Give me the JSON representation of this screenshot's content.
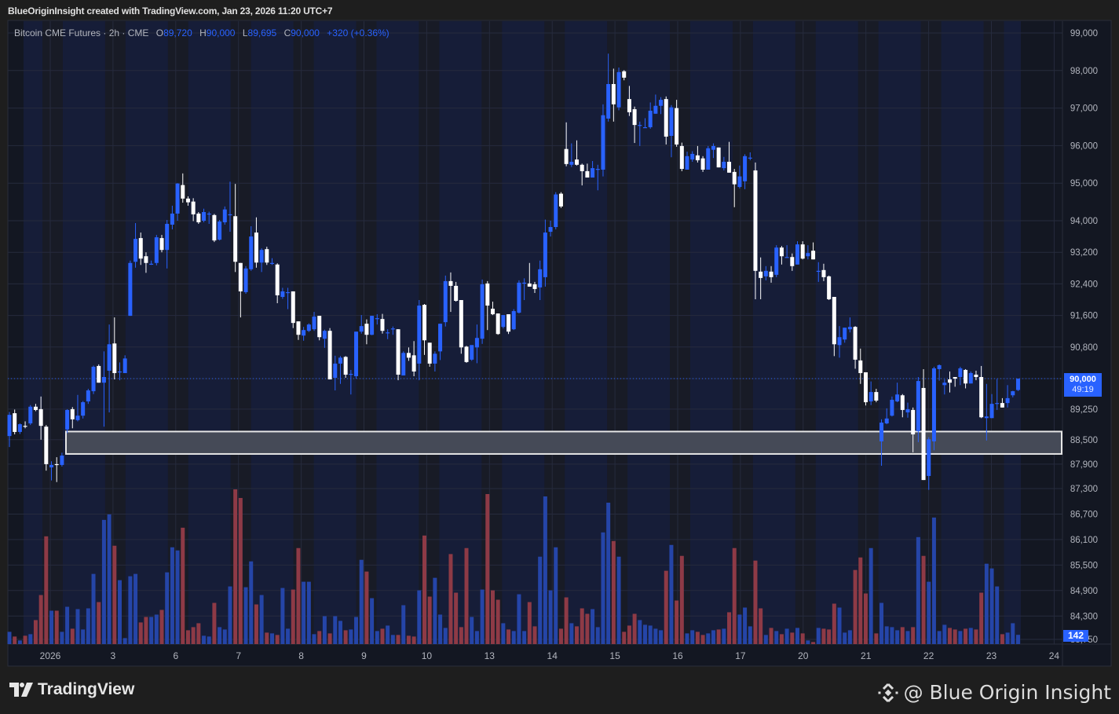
{
  "header": {
    "attribution": "BlueOriginInsight created with TradingView.com, Jan 23, 2026 11:20 UTC+7"
  },
  "legend": {
    "symbol": "Bitcoin CME Futures · 2h · CME",
    "open_label": "O",
    "open": "89,720",
    "high_label": "H",
    "high": "90,000",
    "low_label": "L",
    "low": "89,695",
    "close_label": "C",
    "close": "90,000",
    "change": "+320 (+0.36%)"
  },
  "current_price": {
    "value": "90,000",
    "countdown": "49:19"
  },
  "current_volume": "142",
  "footer": {
    "brand": "TradingView",
    "watermark": "@ Blue Origin Insight"
  },
  "colors": {
    "up": "#2962ff",
    "down": "#ffffff",
    "vol_up": "#2545a8",
    "vol_down": "#8e3a46",
    "accent": "#2962ff"
  },
  "chart_data": {
    "type": "candlestick",
    "title": "Bitcoin CME Futures · 2h · CME",
    "ylim": [
      83750,
      99000
    ],
    "y_ticks": [
      "99,000",
      "98,000",
      "97,000",
      "96,000",
      "95,000",
      "94,000",
      "93,200",
      "92,400",
      "91,600",
      "90,800",
      "90,000",
      "89,250",
      "88,500",
      "87,900",
      "87,300",
      "86,700",
      "86,100",
      "85,500",
      "84,900",
      "84,300",
      "83,750"
    ],
    "x_ticks": [
      "2026",
      "3",
      "6",
      "7",
      "8",
      "9",
      "10",
      "13",
      "14",
      "15",
      "16",
      "17",
      "20",
      "21",
      "22",
      "23",
      "24"
    ],
    "zone": {
      "top": 88700,
      "bottom": 88150
    },
    "current_price": 90000,
    "ohlc": [
      [
        88590,
        89180,
        88320,
        89110
      ],
      [
        89150,
        89240,
        88630,
        88690
      ],
      [
        88690,
        88900,
        88640,
        88880
      ],
      [
        88840,
        88950,
        88780,
        88820
      ],
      [
        88900,
        89350,
        88860,
        89310
      ],
      [
        89310,
        89380,
        89200,
        89230
      ],
      [
        89250,
        89560,
        88500,
        88840
      ],
      [
        88820,
        88860,
        87740,
        87900
      ],
      [
        87820,
        87970,
        87500,
        87880
      ],
      [
        87900,
        88070,
        87460,
        87880
      ],
      [
        87880,
        88180,
        87840,
        88110
      ],
      [
        88750,
        89250,
        88660,
        89230
      ],
      [
        89250,
        89300,
        88780,
        89000
      ],
      [
        88980,
        89600,
        88950,
        89090
      ],
      [
        89090,
        89450,
        89020,
        89420
      ],
      [
        89440,
        89750,
        89380,
        89710
      ],
      [
        89690,
        90330,
        89620,
        90300
      ],
      [
        90320,
        90360,
        89900,
        89900
      ],
      [
        89900,
        90690,
        88820,
        90040
      ],
      [
        90200,
        91370,
        89170,
        90870
      ],
      [
        90890,
        91550,
        89980,
        90140
      ],
      [
        90180,
        90410,
        89960,
        90180
      ],
      [
        90140,
        90590,
        90140,
        90510
      ],
      [
        91590,
        92990,
        91590,
        92930
      ],
      [
        92960,
        93940,
        92810,
        93540
      ],
      [
        93560,
        93700,
        92880,
        93040
      ],
      [
        93100,
        93200,
        92680,
        92930
      ],
      [
        92910,
        92990,
        92880,
        92910
      ],
      [
        92930,
        93640,
        92870,
        93580
      ],
      [
        93560,
        93640,
        93200,
        93260
      ],
      [
        93260,
        94020,
        92790,
        93920
      ],
      [
        93900,
        94400,
        93780,
        94190
      ],
      [
        94190,
        95000,
        94000,
        94990
      ],
      [
        94950,
        95260,
        94480,
        94590
      ],
      [
        94590,
        94650,
        94400,
        94490
      ],
      [
        94510,
        94600,
        93990,
        94170
      ],
      [
        94190,
        94230,
        93920,
        93960
      ],
      [
        94000,
        94320,
        93960,
        94230
      ],
      [
        94190,
        94240,
        93920,
        94190
      ],
      [
        94150,
        94180,
        93460,
        93500
      ],
      [
        93520,
        94020,
        93500,
        93980
      ],
      [
        93960,
        94380,
        93900,
        94300
      ],
      [
        94170,
        95040,
        93720,
        94170
      ],
      [
        94120,
        94980,
        92700,
        92960
      ],
      [
        92930,
        92930,
        91550,
        92210
      ],
      [
        92190,
        92850,
        92150,
        92790
      ],
      [
        92770,
        93860,
        92730,
        93600
      ],
      [
        93700,
        94090,
        92810,
        92940
      ],
      [
        92940,
        93300,
        92700,
        93260
      ],
      [
        93280,
        93340,
        92880,
        92940
      ],
      [
        92930,
        93050,
        92880,
        92930
      ],
      [
        92890,
        92920,
        91910,
        92110
      ],
      [
        92070,
        92300,
        92020,
        92210
      ],
      [
        92190,
        92300,
        91760,
        92190
      ],
      [
        92210,
        92210,
        91280,
        91410
      ],
      [
        91450,
        91450,
        90980,
        91110
      ],
      [
        91090,
        91310,
        90960,
        91230
      ],
      [
        91210,
        91400,
        91180,
        91370
      ],
      [
        91250,
        91690,
        91210,
        91570
      ],
      [
        91590,
        91590,
        90970,
        91050
      ],
      [
        91010,
        91240,
        90780,
        91210
      ],
      [
        91210,
        91280,
        89980,
        89980
      ],
      [
        90020,
        90580,
        89710,
        90380
      ],
      [
        90380,
        90570,
        89870,
        90530
      ],
      [
        90550,
        90570,
        90020,
        90100
      ],
      [
        90120,
        90220,
        89610,
        90120
      ],
      [
        90060,
        91190,
        90000,
        91190
      ],
      [
        91190,
        91610,
        91140,
        91330
      ],
      [
        91390,
        91500,
        90870,
        91110
      ],
      [
        91110,
        91590,
        91100,
        91590
      ],
      [
        91530,
        91630,
        91370,
        91530
      ],
      [
        91510,
        91640,
        91140,
        91210
      ],
      [
        91170,
        91250,
        91000,
        91170
      ],
      [
        91270,
        91320,
        91110,
        91270
      ],
      [
        91250,
        91250,
        89960,
        90100
      ],
      [
        90080,
        90690,
        90080,
        90650
      ],
      [
        90650,
        90790,
        90450,
        90530
      ],
      [
        90590,
        90950,
        90060,
        90180
      ],
      [
        90380,
        91990,
        89960,
        91850
      ],
      [
        91870,
        91890,
        90600,
        90970
      ],
      [
        90910,
        90910,
        90300,
        90380
      ],
      [
        90380,
        90690,
        90180,
        90630
      ],
      [
        90690,
        91390,
        90470,
        91390
      ],
      [
        91430,
        92610,
        91320,
        92470
      ],
      [
        92470,
        92690,
        91690,
        92350
      ],
      [
        92350,
        92450,
        91950,
        91970
      ],
      [
        91990,
        91990,
        90630,
        90790
      ],
      [
        90810,
        90830,
        90400,
        90420
      ],
      [
        90480,
        90830,
        90450,
        90850
      ],
      [
        90790,
        91370,
        90390,
        91030
      ],
      [
        91010,
        92510,
        90880,
        92390
      ],
      [
        92410,
        92470,
        91230,
        91850
      ],
      [
        91770,
        91950,
        91610,
        91630
      ],
      [
        91650,
        91650,
        91110,
        91130
      ],
      [
        91310,
        91610,
        91270,
        91610
      ],
      [
        91630,
        91630,
        91130,
        91190
      ],
      [
        91250,
        91760,
        91230,
        91710
      ],
      [
        91670,
        92490,
        91650,
        92430
      ],
      [
        92430,
        92540,
        91990,
        92430
      ],
      [
        92410,
        92930,
        92330,
        92330
      ],
      [
        92390,
        92450,
        92170,
        92270
      ],
      [
        92310,
        92990,
        91990,
        92770
      ],
      [
        92570,
        94030,
        92330,
        93700
      ],
      [
        93720,
        94000,
        93600,
        93840
      ],
      [
        93840,
        94760,
        93780,
        94700
      ],
      [
        94720,
        94760,
        94340,
        94380
      ],
      [
        95910,
        96620,
        95450,
        95510
      ],
      [
        95490,
        96060,
        95430,
        95570
      ],
      [
        95630,
        96140,
        95470,
        95490
      ],
      [
        95490,
        95520,
        94940,
        95320
      ],
      [
        95320,
        95520,
        95150,
        95150
      ],
      [
        95150,
        95590,
        95150,
        95400
      ],
      [
        95380,
        95490,
        94810,
        95380
      ],
      [
        95360,
        97100,
        95180,
        96810
      ],
      [
        96720,
        98450,
        96640,
        97640
      ],
      [
        97640,
        98050,
        96640,
        97100
      ],
      [
        97020,
        98080,
        96940,
        97960
      ],
      [
        97980,
        98010,
        97740,
        97810
      ],
      [
        97240,
        97590,
        96790,
        96890
      ],
      [
        96970,
        97040,
        96070,
        96550
      ],
      [
        96550,
        96640,
        95990,
        96550
      ],
      [
        96490,
        96730,
        96490,
        96490
      ],
      [
        96490,
        97150,
        96450,
        96930
      ],
      [
        96850,
        97360,
        96850,
        97060
      ],
      [
        97060,
        97290,
        96840,
        97220
      ],
      [
        97240,
        97310,
        96030,
        96240
      ],
      [
        96260,
        97080,
        95690,
        97020
      ],
      [
        97000,
        97220,
        95970,
        96030
      ],
      [
        95990,
        96080,
        95320,
        95380
      ],
      [
        95360,
        95840,
        95360,
        95720
      ],
      [
        95630,
        95850,
        95570,
        95780
      ],
      [
        95740,
        95990,
        95550,
        95610
      ],
      [
        95660,
        95720,
        95300,
        95360
      ],
      [
        95360,
        95990,
        95360,
        95930
      ],
      [
        95890,
        96060,
        95670,
        95990
      ],
      [
        95950,
        95950,
        95420,
        95420
      ],
      [
        95400,
        95700,
        95340,
        95570
      ],
      [
        95570,
        96100,
        95280,
        95280
      ],
      [
        95300,
        95380,
        94360,
        94970
      ],
      [
        94900,
        95470,
        94860,
        95180
      ],
      [
        95050,
        95770,
        94840,
        95720
      ],
      [
        95680,
        95820,
        95610,
        95680
      ],
      [
        95340,
        95550,
        92010,
        92730
      ],
      [
        92710,
        93070,
        92010,
        92550
      ],
      [
        92590,
        92850,
        92490,
        92730
      ],
      [
        92710,
        92850,
        92430,
        92570
      ],
      [
        92630,
        93380,
        92570,
        93320
      ],
      [
        93320,
        93360,
        92890,
        93100
      ],
      [
        93080,
        93380,
        93080,
        93080
      ],
      [
        93080,
        93170,
        92730,
        92850
      ],
      [
        92890,
        93480,
        92890,
        93400
      ],
      [
        93400,
        93480,
        93020,
        93040
      ],
      [
        93100,
        93380,
        93020,
        93180
      ],
      [
        93240,
        93450,
        93020,
        93020
      ],
      [
        92730,
        92950,
        92450,
        92730
      ],
      [
        92750,
        92910,
        92470,
        92570
      ],
      [
        92590,
        92610,
        91990,
        92010
      ],
      [
        92070,
        92070,
        90570,
        90870
      ],
      [
        90850,
        91330,
        90530,
        91050
      ],
      [
        90990,
        91290,
        90910,
        91290
      ],
      [
        91250,
        91550,
        91170,
        91310
      ],
      [
        91310,
        91330,
        90250,
        90480
      ],
      [
        90460,
        90760,
        89870,
        90140
      ],
      [
        90160,
        90160,
        89340,
        89420
      ],
      [
        89440,
        89930,
        89350,
        89670
      ],
      [
        89670,
        89750,
        89420,
        89460
      ],
      [
        88460,
        89000,
        87860,
        88920
      ],
      [
        88900,
        89270,
        88880,
        89020
      ],
      [
        89090,
        89560,
        89070,
        89480
      ],
      [
        89440,
        89900,
        89420,
        89610
      ],
      [
        89590,
        89620,
        89050,
        89230
      ],
      [
        89170,
        89410,
        89040,
        89250
      ],
      [
        89230,
        89290,
        88190,
        88630
      ],
      [
        88710,
        90040,
        88440,
        89940
      ],
      [
        89770,
        90240,
        87510,
        87510
      ],
      [
        87610,
        88560,
        87270,
        88510
      ],
      [
        88460,
        90300,
        88240,
        90260
      ],
      [
        90240,
        90360,
        89950,
        90340
      ],
      [
        89840,
        89980,
        89610,
        89900
      ],
      [
        89980,
        90180,
        89660,
        89900
      ],
      [
        90040,
        90040,
        89800,
        90000
      ],
      [
        90040,
        90300,
        89840,
        90260
      ],
      [
        90220,
        90240,
        89760,
        89880
      ],
      [
        89880,
        90180,
        89880,
        90140
      ],
      [
        90100,
        90200,
        89960,
        90040
      ],
      [
        90040,
        90320,
        89030,
        89050
      ],
      [
        89030,
        89870,
        88480,
        89070
      ],
      [
        89030,
        89620,
        89030,
        89380
      ],
      [
        89380,
        89990,
        89230,
        89400
      ],
      [
        89400,
        89520,
        89290,
        89290
      ],
      [
        89400,
        89840,
        89290,
        89520
      ],
      [
        89590,
        89700,
        89540,
        89690
      ],
      [
        89720,
        90000,
        89695,
        90000
      ]
    ],
    "volume": [
      188,
      116,
      56,
      128,
      152,
      368,
      752,
      1652,
      512,
      512,
      188,
      572,
      236,
      536,
      224,
      548,
      1076,
      644,
      1904,
      1988,
      1508,
      980,
      92,
      1040,
      1076,
      332,
      416,
      416,
      452,
      524,
      1100,
      1484,
      1436,
      1784,
      212,
      260,
      320,
      128,
      116,
      632,
      260,
      224,
      884,
      2372,
      2240,
      872,
      1268,
      608,
      752,
      176,
      164,
      140,
      860,
      236,
      836,
      1472,
      956,
      956,
      152,
      200,
      428,
      164,
      428,
      356,
      212,
      224,
      416,
      1292,
      1112,
      704,
      200,
      236,
      284,
      140,
      140,
      596,
      128,
      116,
      824,
      1664,
      728,
      1016,
      452,
      248,
      1380,
      788,
      260,
      1472,
      416,
      200,
      836,
      2300,
      824,
      680,
      320,
      224,
      200,
      764,
      200,
      644,
      272,
      1340,
      2264,
      824,
      1484,
      236,
      716,
      320,
      272,
      548,
      464,
      536,
      260,
      1712,
      2168,
      1580,
      1340,
      188,
      284,
      464,
      368,
      296,
      284,
      236,
      212,
      1124,
      1520,
      668,
      1352,
      164,
      212,
      188,
      140,
      164,
      212,
      224,
      236,
      488,
      1472,
      452,
      560,
      272,
      1280,
      548,
      140,
      248,
      200,
      152,
      236,
      176,
      248,
      164,
      56,
      32,
      248,
      236,
      224,
      620,
      560,
      176,
      212,
      1136,
      1328,
      776,
      1472,
      164,
      632,
      272,
      260,
      212,
      260,
      200,
      260,
      1640,
      1352,
      956,
      1940,
      200,
      296,
      248,
      224,
      200,
      236,
      248,
      224,
      788,
      1232,
      1160,
      884,
      152,
      176,
      320,
      142
    ]
  }
}
